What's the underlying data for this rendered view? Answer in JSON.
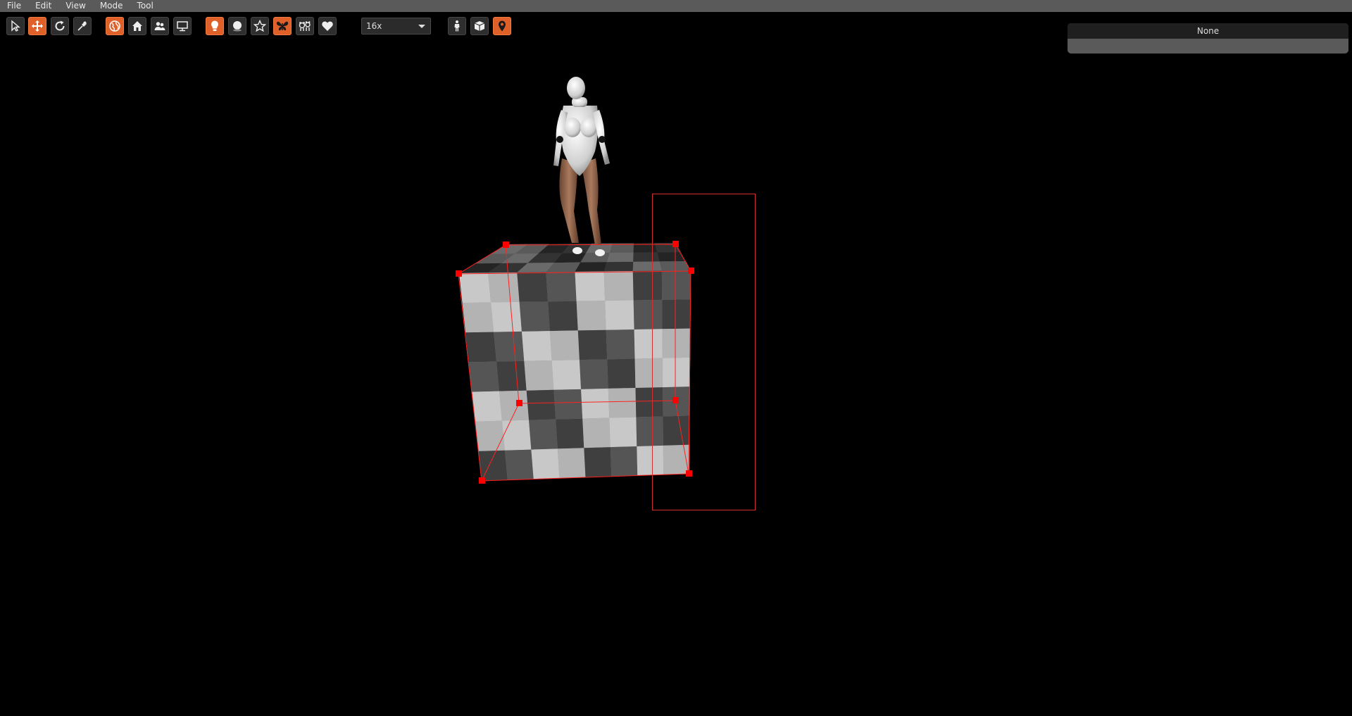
{
  "menu": {
    "items": [
      "File",
      "Edit",
      "View",
      "Mode",
      "Tool"
    ]
  },
  "toolbar": {
    "groups": [
      [
        {
          "icon": "select-arrow-icon",
          "active": false
        },
        {
          "icon": "move-arrows-icon",
          "active": true
        },
        {
          "icon": "rotate-icon",
          "active": false
        },
        {
          "icon": "pin-brush-icon",
          "active": false
        }
      ],
      [
        {
          "icon": "globe-icon",
          "active": true
        },
        {
          "icon": "home-icon",
          "active": false
        },
        {
          "icon": "people-icon",
          "active": false
        },
        {
          "icon": "monitor-icon",
          "active": false
        }
      ],
      [
        {
          "icon": "lightbulb-icon",
          "active": true
        },
        {
          "icon": "sphere-icon",
          "active": false
        },
        {
          "icon": "star-icon",
          "active": false
        },
        {
          "icon": "butterfly-icon",
          "active": true
        },
        {
          "icon": "bears-icon",
          "active": false
        },
        {
          "icon": "heart-icon",
          "active": false
        }
      ],
      [
        {
          "icon": "figure-icon",
          "active": false
        },
        {
          "icon": "box-icon",
          "active": false
        },
        {
          "icon": "location-pin-icon",
          "active": true
        }
      ]
    ],
    "zoom_value": "16x"
  },
  "panel": {
    "title": "None"
  },
  "colors": {
    "accent": "#e0602a",
    "selection": "#ff0000",
    "menubar": "#5a5a5a"
  }
}
